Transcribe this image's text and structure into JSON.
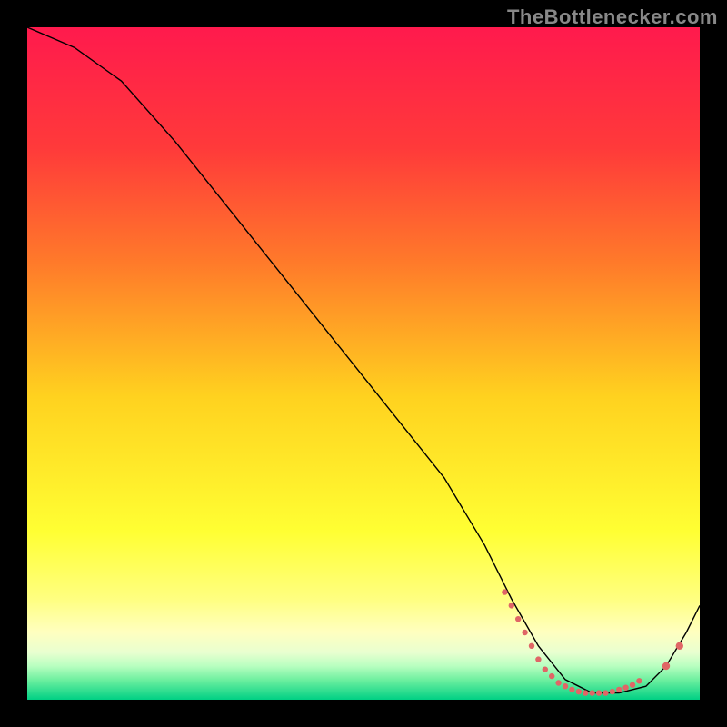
{
  "watermark": "TheBottlenecker.com",
  "chart_data": {
    "type": "line",
    "title": "",
    "xlabel": "",
    "ylabel": "",
    "xlim": [
      0,
      100
    ],
    "ylim": [
      0,
      100
    ],
    "grid": false,
    "background_gradient": {
      "stops": [
        {
          "offset": 0.0,
          "color": "#ff1a4d"
        },
        {
          "offset": 0.18,
          "color": "#ff3a3a"
        },
        {
          "offset": 0.35,
          "color": "#ff7a2a"
        },
        {
          "offset": 0.55,
          "color": "#ffd21f"
        },
        {
          "offset": 0.75,
          "color": "#ffff33"
        },
        {
          "offset": 0.85,
          "color": "#ffff80"
        },
        {
          "offset": 0.9,
          "color": "#ffffc0"
        },
        {
          "offset": 0.93,
          "color": "#e8ffd0"
        },
        {
          "offset": 0.95,
          "color": "#b8ffc0"
        },
        {
          "offset": 0.97,
          "color": "#70f0a0"
        },
        {
          "offset": 1.0,
          "color": "#00d084"
        }
      ]
    },
    "annotations_visible": false,
    "series": [
      {
        "name": "bottleneck-curve",
        "stroke": "#000000",
        "stroke_width": 1.4,
        "x": [
          0,
          7,
          14,
          22,
          30,
          38,
          46,
          54,
          62,
          68,
          72,
          76,
          80,
          84,
          88,
          92,
          95,
          98,
          100
        ],
        "values": [
          100,
          97,
          92,
          83,
          73,
          63,
          53,
          43,
          33,
          23,
          15,
          8,
          3,
          1,
          1,
          2,
          5,
          10,
          14
        ]
      }
    ],
    "marker_points": {
      "name": "highlight-dots",
      "color": "#e06666",
      "radius_cluster": 3.2,
      "radius_outlier": 4.2,
      "points": [
        {
          "x": 71,
          "y": 16
        },
        {
          "x": 72,
          "y": 14
        },
        {
          "x": 73,
          "y": 12
        },
        {
          "x": 74,
          "y": 10
        },
        {
          "x": 75,
          "y": 8
        },
        {
          "x": 76,
          "y": 6
        },
        {
          "x": 77,
          "y": 4.5
        },
        {
          "x": 78,
          "y": 3.5
        },
        {
          "x": 79,
          "y": 2.5
        },
        {
          "x": 80,
          "y": 2
        },
        {
          "x": 81,
          "y": 1.5
        },
        {
          "x": 82,
          "y": 1.2
        },
        {
          "x": 83,
          "y": 1
        },
        {
          "x": 84,
          "y": 1
        },
        {
          "x": 85,
          "y": 1
        },
        {
          "x": 86,
          "y": 1
        },
        {
          "x": 87,
          "y": 1.2
        },
        {
          "x": 88,
          "y": 1.5
        },
        {
          "x": 89,
          "y": 1.8
        },
        {
          "x": 90,
          "y": 2.2
        },
        {
          "x": 91,
          "y": 2.8
        },
        {
          "x": 95,
          "y": 5,
          "outlier": true
        },
        {
          "x": 97,
          "y": 8,
          "outlier": true
        }
      ]
    }
  }
}
